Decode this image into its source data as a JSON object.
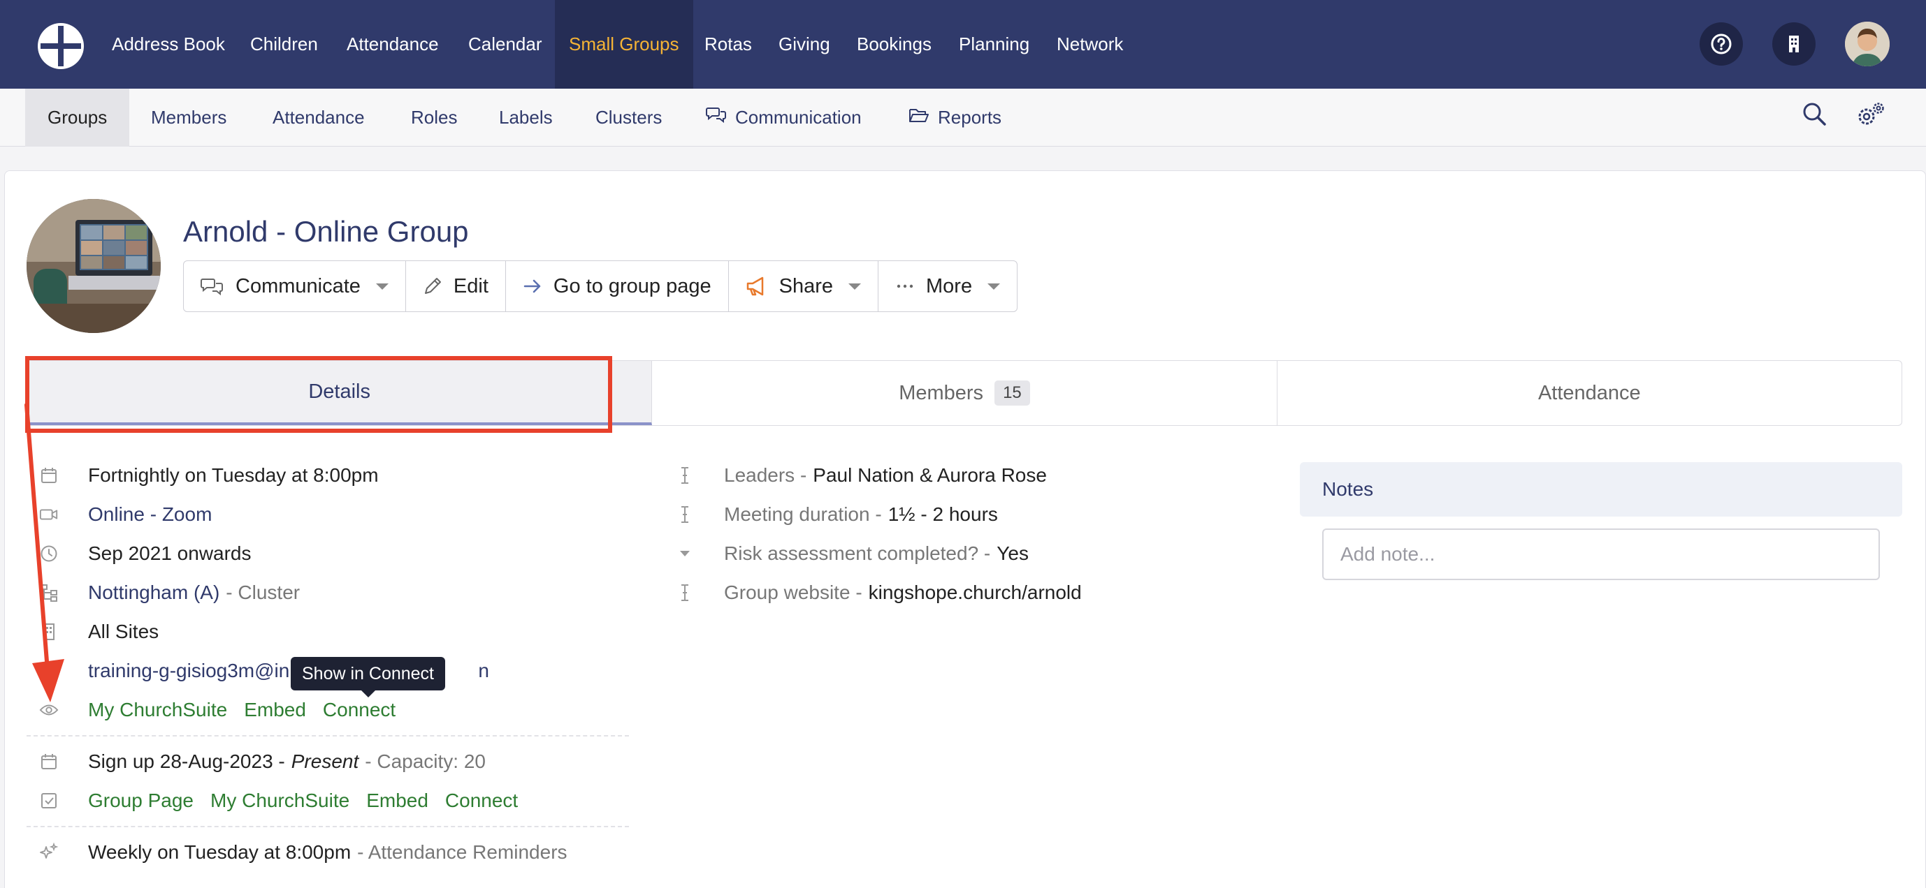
{
  "topnav": {
    "items": [
      {
        "label": "Address Book"
      },
      {
        "label": "Children"
      },
      {
        "label": "Attendance"
      },
      {
        "label": "Calendar"
      },
      {
        "label": "Small Groups",
        "active": true
      },
      {
        "label": "Rotas"
      },
      {
        "label": "Giving"
      },
      {
        "label": "Bookings"
      },
      {
        "label": "Planning"
      },
      {
        "label": "Network"
      }
    ],
    "icons": [
      "help-icon",
      "building-icon",
      "user-avatar"
    ],
    "colors": {
      "background": "#303a6b",
      "active_bg": "#252d55",
      "active_text": "#f5b335"
    }
  },
  "subnav": {
    "items": [
      {
        "label": "Groups",
        "active": true
      },
      {
        "label": "Members"
      },
      {
        "label": "Attendance"
      },
      {
        "label": "Roles"
      },
      {
        "label": "Labels"
      },
      {
        "label": "Clusters"
      },
      {
        "label": "Communication",
        "icon": "speech-bubbles-icon"
      },
      {
        "label": "Reports",
        "icon": "folder-open-icon"
      }
    ],
    "right_icons": [
      "search-icon",
      "settings-gears-icon"
    ]
  },
  "group": {
    "title": "Arnold - Online Group",
    "actions": {
      "communicate": "Communicate",
      "edit": "Edit",
      "go_to_page": "Go to group page",
      "share": "Share",
      "more": "More"
    }
  },
  "tabs": {
    "details": "Details",
    "members": "Members",
    "members_count": "15",
    "attendance": "Attendance"
  },
  "details": {
    "schedule": "Fortnightly on Tuesday at 8:00pm",
    "location": "Online - Zoom",
    "start": "Sep 2021 onwards",
    "cluster_name": "Nottingham (A)",
    "cluster_suffix": "- Cluster",
    "site": "All Sites",
    "email": "training-g-gisiog3m@in",
    "email_tail": "n",
    "visibility": {
      "my_churchsuite": "My ChurchSuite",
      "embed": "Embed",
      "connect": "Connect"
    },
    "signup_prefix": "Sign up 28-Aug-2023 -",
    "signup_present": "Present",
    "signup_capacity": "- Capacity: 20",
    "signup_links": {
      "group_page": "Group Page",
      "my_churchsuite": "My ChurchSuite",
      "embed": "Embed",
      "connect": "Connect"
    },
    "reminders": "Weekly on Tuesday at 8:00pm",
    "reminders_suffix": "- Attendance Reminders"
  },
  "custom_fields": {
    "leaders_label": "Leaders -",
    "leaders_value": "Paul Nation & Aurora Rose",
    "duration_label": "Meeting duration -",
    "duration_value": "1½ - 2 hours",
    "risk_label": "Risk assessment completed? -",
    "risk_value": "Yes",
    "website_label": "Group website -",
    "website_value": "kingshope.church/arnold"
  },
  "notes": {
    "title": "Notes",
    "placeholder": "Add note..."
  },
  "tooltip": {
    "text": "Show in Connect"
  },
  "annotation": {
    "color": "#e8412b"
  }
}
